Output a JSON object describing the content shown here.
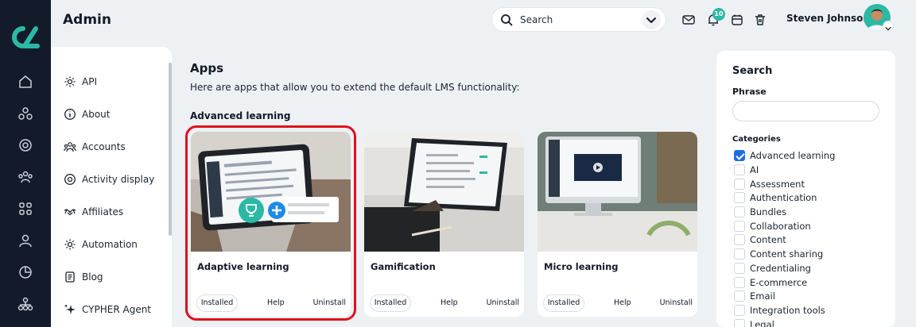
{
  "header": {
    "title": "Admin",
    "search_label": "Search",
    "notification_count": "10",
    "user_name": "Steven Johnson"
  },
  "sidebar": {
    "items": [
      {
        "label": "API",
        "icon": "gear-icon"
      },
      {
        "label": "About",
        "icon": "info-icon"
      },
      {
        "label": "Accounts",
        "icon": "users-icon"
      },
      {
        "label": "Activity display",
        "icon": "target-icon"
      },
      {
        "label": "Affiliates",
        "icon": "handshake-icon"
      },
      {
        "label": "Automation",
        "icon": "gear-icon"
      },
      {
        "label": "Blog",
        "icon": "document-icon"
      },
      {
        "label": "CYPHER Agent",
        "icon": "sparkle-icon"
      }
    ]
  },
  "main": {
    "title": "Apps",
    "description": "Here are apps that allow you to extend the default LMS functionality:",
    "section_title": "Advanced learning",
    "cards": [
      {
        "name": "Adaptive learning",
        "installed_label": "Installed",
        "help_label": "Help",
        "uninstall_label": "Uninstall"
      },
      {
        "name": "Gamification",
        "installed_label": "Installed",
        "help_label": "Help",
        "uninstall_label": "Uninstall"
      },
      {
        "name": "Micro learning",
        "installed_label": "Installed",
        "help_label": "Help",
        "uninstall_label": "Uninstall"
      }
    ]
  },
  "filters": {
    "title": "Search",
    "phrase_label": "Phrase",
    "phrase_value": "",
    "categories_label": "Categories",
    "categories": [
      {
        "label": "Advanced learning",
        "checked": true
      },
      {
        "label": "AI",
        "checked": false
      },
      {
        "label": "Assessment",
        "checked": false
      },
      {
        "label": "Authentication",
        "checked": false
      },
      {
        "label": "Bundles",
        "checked": false
      },
      {
        "label": "Collaboration",
        "checked": false
      },
      {
        "label": "Content",
        "checked": false
      },
      {
        "label": "Content sharing",
        "checked": false
      },
      {
        "label": "Credentialing",
        "checked": false
      },
      {
        "label": "E-commerce",
        "checked": false
      },
      {
        "label": "Email",
        "checked": false
      },
      {
        "label": "Integration tools",
        "checked": false
      },
      {
        "label": "Legal",
        "checked": false
      }
    ]
  },
  "colors": {
    "accent": "#2bb9a5",
    "rail": "#131b2b",
    "highlight": "#e0101c",
    "checkbox": "#1d6fe0"
  }
}
